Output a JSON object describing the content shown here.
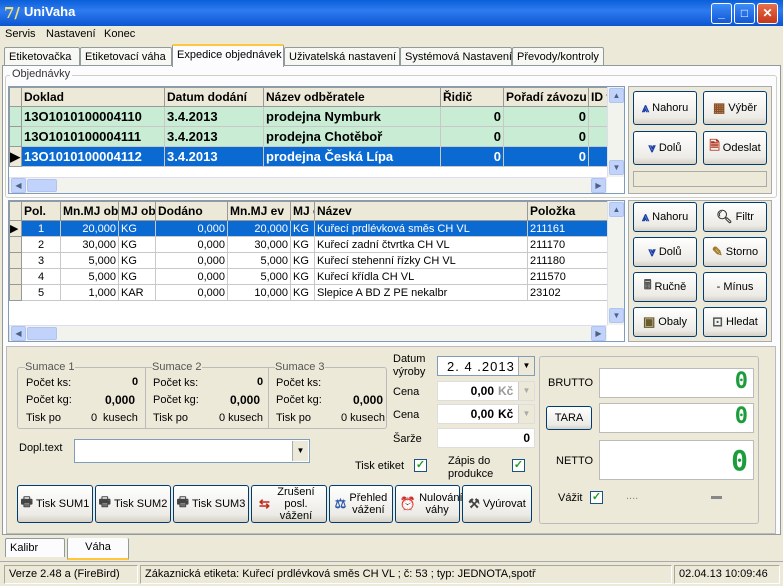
{
  "window": {
    "title": "UniVaha",
    "app_icon_glyph": "7/"
  },
  "menu": [
    "Servis",
    "Nastavení",
    "Konec"
  ],
  "tabs": [
    "Etiketovačka",
    "Etiketovací váha",
    "Expedice objednávek",
    "Uživatelská nastavení",
    "Systémová Nastavení",
    "Převody/kontroly"
  ],
  "orders": {
    "group_label": "Objednávky",
    "columns": [
      "Doklad",
      "Datum dodání",
      "Název odběratele",
      "Řidič",
      "Pořadí závozu",
      "ID fi"
    ],
    "rows": [
      {
        "doklad": "13O1010100004110",
        "datum": "3.4.2013",
        "nazev": "prodejna Nymburk",
        "ridic": "0",
        "poradi": "0"
      },
      {
        "doklad": "13O1010100004111",
        "datum": "3.4.2013",
        "nazev": "prodejna Chotěboř",
        "ridic": "0",
        "poradi": "0"
      },
      {
        "doklad": "13O1010100004112",
        "datum": "3.4.2013",
        "nazev": "prodejna Česká Lípa",
        "ridic": "0",
        "poradi": "0"
      }
    ],
    "buttons": {
      "up": "Nahoru",
      "select": "Výběr",
      "down": "Dolů",
      "send": "Odeslat"
    }
  },
  "items": {
    "columns": [
      "Pol.",
      "Mn.MJ ob",
      "MJ ob",
      "Dodáno",
      "Mn.MJ ev",
      "MJ e",
      "Název",
      "Položka"
    ],
    "rows": [
      {
        "pol": "1",
        "mn": "20,000",
        "mj": "KG",
        "dod": "0,000",
        "mnev": "20,000",
        "mje": "KG",
        "nazev": "Kuřecí prdlévková směs CH VL",
        "polozka": "211161"
      },
      {
        "pol": "2",
        "mn": "30,000",
        "mj": "KG",
        "dod": "0,000",
        "mnev": "30,000",
        "mje": "KG",
        "nazev": "Kuřecí zadní čtvrtka CH VL",
        "polozka": "211170"
      },
      {
        "pol": "3",
        "mn": "5,000",
        "mj": "KG",
        "dod": "0,000",
        "mnev": "5,000",
        "mje": "KG",
        "nazev": "Kuřecí stehenní řízky CH VL",
        "polozka": "211180"
      },
      {
        "pol": "4",
        "mn": "5,000",
        "mj": "KG",
        "dod": "0,000",
        "mnev": "5,000",
        "mje": "KG",
        "nazev": "Kuřecí křídla CH VL",
        "polozka": "211570"
      },
      {
        "pol": "5",
        "mn": "1,000",
        "mj": "KAR",
        "dod": "0,000",
        "mnev": "10,000",
        "mje": "KG",
        "nazev": "Slepice A BD Z PE nekalbr",
        "polozka": "23102"
      }
    ],
    "buttons": {
      "up": "Nahoru",
      "filter": "Filtr",
      "down": "Dolů",
      "storno": "Storno",
      "manual": "Ručně",
      "minus": "- Mínus",
      "packaging": "Obaly",
      "search": "Hledat"
    }
  },
  "sums": [
    {
      "title": "Sumace 1",
      "count_label": "Počet ks:",
      "count": "0",
      "kg_label": "Počet kg:",
      "kg": "0,000",
      "print_label": "Tisk po",
      "print_val": "0",
      "unit": "kusech"
    },
    {
      "title": "Sumace 2",
      "count_label": "Počet ks:",
      "count": "0",
      "kg_label": "Počet kg:",
      "kg": "0,000",
      "print_label": "Tisk po",
      "print_val": "0 kusech",
      "unit": ""
    },
    {
      "title": "Sumace 3",
      "count_label": "Počet ks:",
      "count": "",
      "kg_label": "Počet kg:",
      "kg": "0,000",
      "print_label": "Tisk po",
      "print_val": "0 kusech",
      "unit": ""
    }
  ],
  "form": {
    "date_label": "Datum výroby",
    "date": "2. 4 .2013",
    "price_label": "Cena",
    "price1": "0,00",
    "currency1": "Kč",
    "price2": "0,00",
    "currency2": "Kč",
    "batch_label": "Šarže",
    "batch": "0",
    "note_label": "Dopl.text",
    "print_label": "Tisk etiket",
    "record_label": "Zápis do produkce",
    "brutto": "BRUTTO",
    "tara": "TARA",
    "netto": "NETTO",
    "weigh_label": "Vážit",
    "weigh_dots": "....",
    "digit_brutto": "0",
    "digit_tara": "0",
    "digit_netto": "0"
  },
  "bottom_buttons": [
    "Tisk SUM1",
    "Tisk SUM2",
    "Tisk SUM3",
    "Zrušení posl. vážení",
    "Přehled vážení",
    "Nulování váhy",
    "Vyúrovat"
  ],
  "bottom_tabs": [
    "Kalibr",
    "Váha"
  ],
  "status": {
    "version": "Verze 2.48 a (FireBird)",
    "message": "Zákaznická etiketa: Kuřecí prdlévková směs CH VL ; č: 53 ; typ: JEDNOTA,spotř",
    "datetime": "02.04.13 10:09:46"
  },
  "colors": {
    "selection": "#0b6ad2",
    "green_row": "#c8ecd4",
    "titlebar": "#0a5fd8",
    "digit": "#1d9c3c"
  }
}
